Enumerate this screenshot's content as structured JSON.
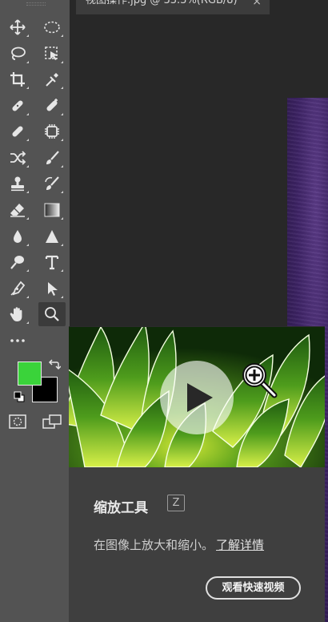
{
  "document_tab": {
    "title": "视图操作.jpg @ 33.3%(RGB/8)",
    "close_glyph": "×"
  },
  "toolbar": {
    "tools": [
      {
        "name": "move-tool",
        "icon": "move-icon"
      },
      {
        "name": "elliptical-marquee-tool",
        "icon": "ellipse-marquee-icon"
      },
      {
        "name": "lasso-tool",
        "icon": "lasso-icon"
      },
      {
        "name": "object-selection-tool",
        "icon": "object-selection-icon"
      },
      {
        "name": "crop-tool",
        "icon": "crop-icon"
      },
      {
        "name": "eyedropper-tool",
        "icon": "eyedropper-icon"
      },
      {
        "name": "spot-healing-brush-tool",
        "icon": "spot-healing-icon"
      },
      {
        "name": "healing-brush-tool",
        "icon": "healing-brush-icon"
      },
      {
        "name": "bandage-tool",
        "icon": "bandage-icon"
      },
      {
        "name": "content-aware-tool",
        "icon": "chip-icon"
      },
      {
        "name": "red-eye-tool",
        "icon": "shuffle-icon"
      },
      {
        "name": "brush-tool",
        "icon": "brush-icon"
      },
      {
        "name": "clone-stamp-tool",
        "icon": "stamp-icon"
      },
      {
        "name": "history-brush-tool",
        "icon": "history-brush-icon"
      },
      {
        "name": "eraser-tool",
        "icon": "eraser-icon"
      },
      {
        "name": "gradient-tool",
        "icon": "gradient-icon"
      },
      {
        "name": "blur-tool",
        "icon": "drop-icon"
      },
      {
        "name": "sharpen-tool",
        "icon": "triangle-icon"
      },
      {
        "name": "dodge-tool",
        "icon": "dodge-icon"
      },
      {
        "name": "type-tool",
        "icon": "type-icon"
      },
      {
        "name": "pen-tool",
        "icon": "pen-icon"
      },
      {
        "name": "path-selection-tool",
        "icon": "arrow-icon"
      },
      {
        "name": "hand-tool",
        "icon": "hand-icon"
      },
      {
        "name": "zoom-tool",
        "icon": "magnifier-icon",
        "active": true
      },
      {
        "name": "edit-toolbar",
        "icon": "more-icon"
      }
    ],
    "foreground_color": "#3ad33a",
    "background_color": "#000000"
  },
  "tooltip": {
    "title": "缩放工具",
    "shortcut": "Z",
    "description": "在图像上放大和缩小。",
    "link_text": "了解详情",
    "button_label": "观看快速视频"
  },
  "colors": {
    "toolbar_bg": "#535353",
    "workspace_bg": "#282828",
    "tooltip_bg": "#3f3f3f",
    "canvas_purple": "#3e2466"
  }
}
